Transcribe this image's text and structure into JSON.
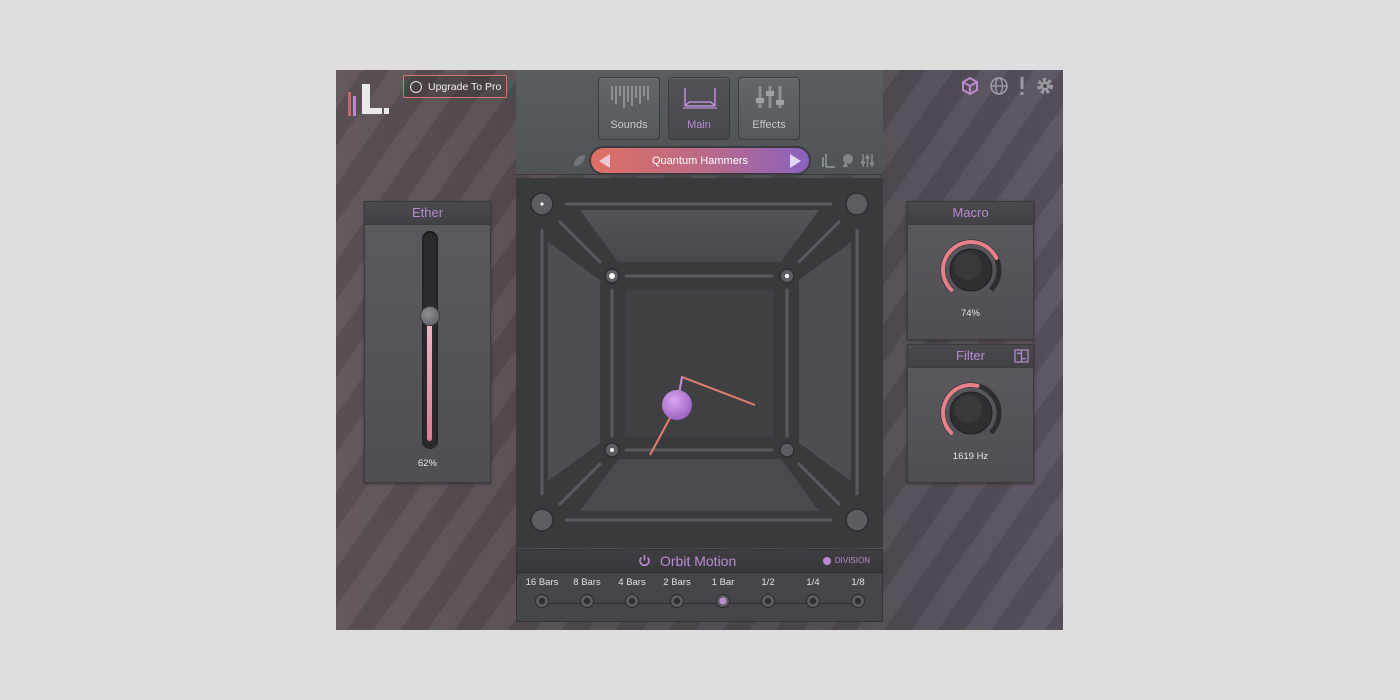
{
  "header": {
    "upgrade_label": "Upgrade To Pro",
    "tabs": [
      {
        "label": "Sounds",
        "active": false
      },
      {
        "label": "Main",
        "active": true
      },
      {
        "label": "Effects",
        "active": false
      }
    ],
    "preset_name": "Quantum Hammers",
    "top_right_icons": [
      "cube-icon",
      "globe-icon",
      "exclamation-icon",
      "gear-icon"
    ]
  },
  "ether": {
    "title": "Ether",
    "value": "62%",
    "level": 0.62
  },
  "macro": {
    "title": "Macro",
    "value": "74%",
    "level": 0.74
  },
  "filter": {
    "title": "Filter",
    "value": "1619 Hz",
    "level": 0.55
  },
  "orbit": {
    "title": "Orbit Motion",
    "division_label": "DIVISION",
    "steps": [
      {
        "label": "16 Bars",
        "active": false
      },
      {
        "label": "8 Bars",
        "active": false
      },
      {
        "label": "4 Bars",
        "active": false
      },
      {
        "label": "2 Bars",
        "active": false
      },
      {
        "label": "1 Bar",
        "active": true
      },
      {
        "label": "1/2",
        "active": false
      },
      {
        "label": "1/4",
        "active": false
      },
      {
        "label": "1/8",
        "active": false
      }
    ]
  },
  "colors": {
    "accent": "#b98ad0",
    "knob_arc": "#e8808a",
    "preset_start": "#df6f62",
    "preset_end": "#8a62c0"
  }
}
